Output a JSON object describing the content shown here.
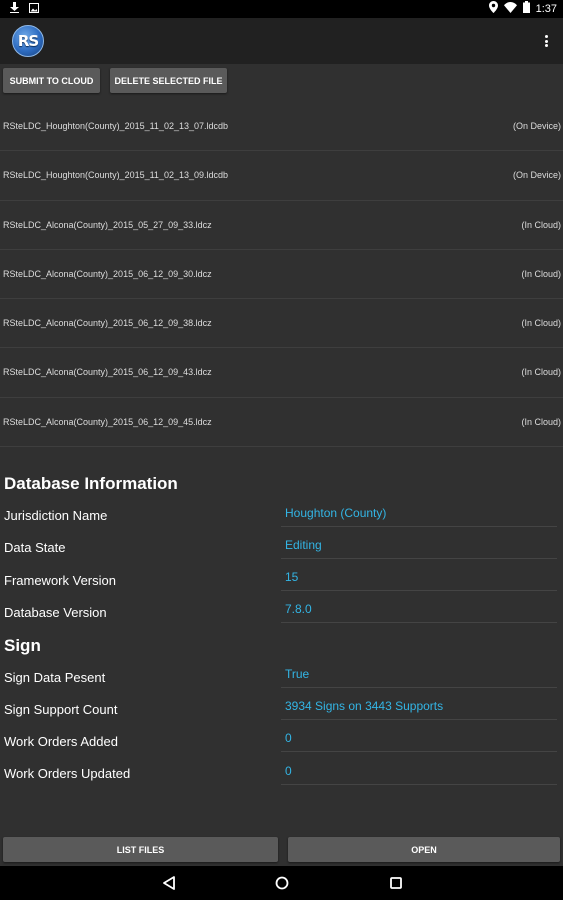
{
  "status_bar": {
    "time": "1:37",
    "left_icons": [
      "download-icon",
      "image-icon"
    ],
    "right_icons": [
      "location-icon",
      "wifi-icon",
      "battery-icon"
    ]
  },
  "app_bar": {
    "logo_text": "RS",
    "overflow_icon": "more-vert-icon"
  },
  "toolbar": {
    "submit_label": "SUBMIT TO CLOUD",
    "delete_label": "DELETE SELECTED FILE"
  },
  "files": [
    {
      "name": "RSteLDC_Houghton(County)_2015_11_02_13_07.ldcdb",
      "location": "(On Device)"
    },
    {
      "name": "RSteLDC_Houghton(County)_2015_11_02_13_09.ldcdb",
      "location": "(On Device)"
    },
    {
      "name": "RSteLDC_Alcona(County)_2015_05_27_09_33.ldcz",
      "location": "(In Cloud)"
    },
    {
      "name": "RSteLDC_Alcona(County)_2015_06_12_09_30.ldcz",
      "location": "(In Cloud)"
    },
    {
      "name": "RSteLDC_Alcona(County)_2015_06_12_09_38.ldcz",
      "location": "(In Cloud)"
    },
    {
      "name": "RSteLDC_Alcona(County)_2015_06_12_09_43.ldcz",
      "location": "(In Cloud)"
    },
    {
      "name": "RSteLDC_Alcona(County)_2015_06_12_09_45.ldcz",
      "location": "(In Cloud)"
    }
  ],
  "database_info": {
    "title": "Database Information",
    "rows": [
      {
        "label": "Jurisdiction Name",
        "value": "Houghton (County)"
      },
      {
        "label": "Data State",
        "value": "Editing"
      },
      {
        "label": "Framework Version",
        "value": "15"
      },
      {
        "label": "Database Version",
        "value": "7.8.0"
      }
    ]
  },
  "sign": {
    "title": "Sign",
    "rows": [
      {
        "label": "Sign Data Pesent",
        "value": "True"
      },
      {
        "label": "Sign Support Count",
        "value": "3934 Signs on 3443 Supports"
      },
      {
        "label": "Work Orders Added",
        "value": "0"
      },
      {
        "label": "Work Orders Updated",
        "value": "0"
      }
    ]
  },
  "bottom_buttons": {
    "list_label": "LIST FILES",
    "open_label": "OPEN"
  },
  "nav_bar": {
    "icons": [
      "back-icon",
      "home-icon",
      "recents-icon"
    ]
  },
  "colors": {
    "accent": "#33b5e5",
    "background": "#303030",
    "app_bar": "#212121",
    "button": "#5a5a5a"
  }
}
